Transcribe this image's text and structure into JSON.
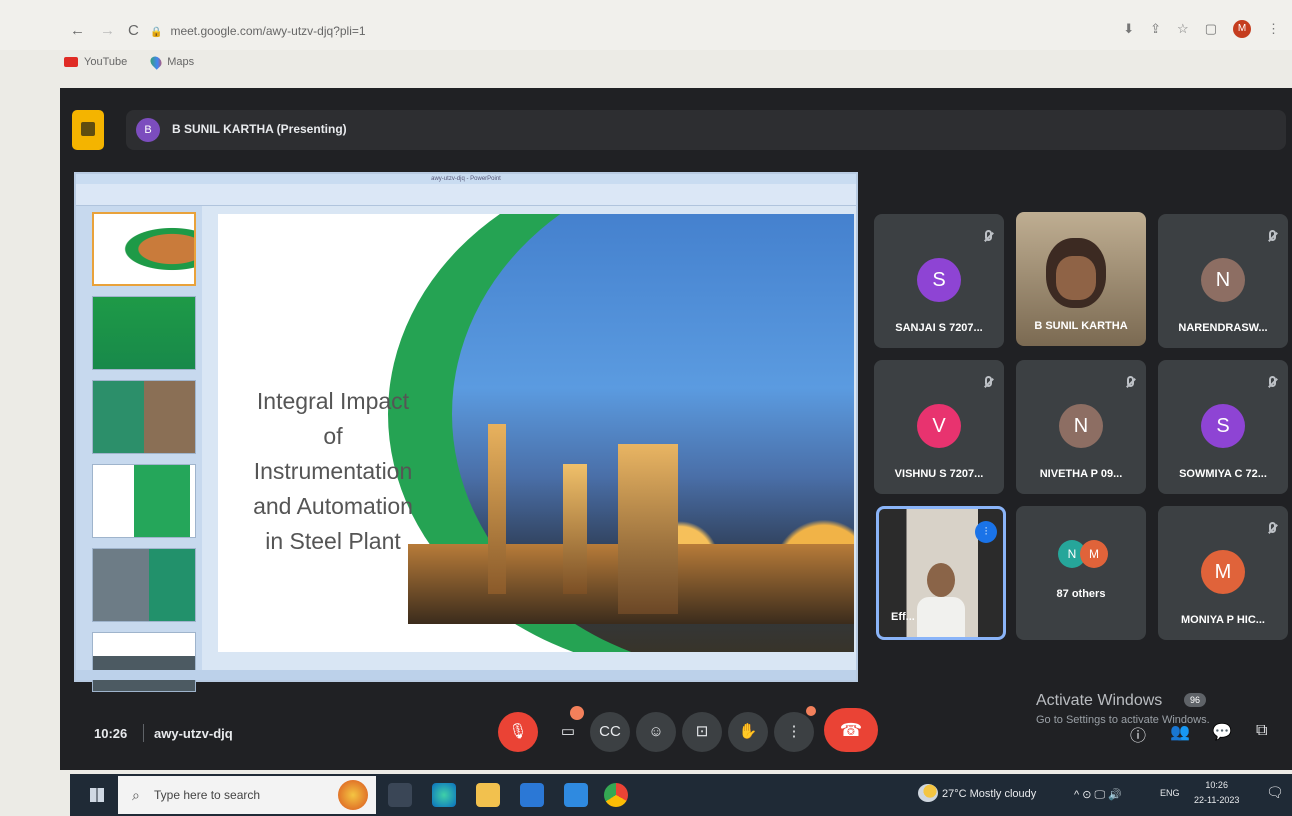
{
  "browser": {
    "url": "meet.google.com/awy-utzv-djq?pli=1",
    "bookmarks": [
      "YouTube",
      "Maps"
    ],
    "profile_initial": "M"
  },
  "meet": {
    "presenter_initial": "B",
    "presenter_label": "B SUNIL KARTHA (Presenting)",
    "slide": {
      "window_title": "awy-utzv-djq - PowerPoint",
      "title_lines": [
        "Integral Impact",
        "of",
        "Instrumentation",
        "and Automation",
        "in Steel Plant"
      ]
    },
    "participants": [
      {
        "name": "SANJAI S 7207...",
        "initial": "S",
        "color": "#8e44d4",
        "muted": true
      },
      {
        "name": "B SUNIL KARTHA",
        "video": true
      },
      {
        "name": "NARENDRASW...",
        "initial": "N",
        "color": "#8d6e63",
        "muted": true
      },
      {
        "name": "VISHNU S 7207...",
        "initial": "V",
        "color": "#e8336f",
        "muted": true
      },
      {
        "name": "NIVETHA P 09...",
        "initial": "N",
        "color": "#8d6e63",
        "muted": true
      },
      {
        "name": "SOWMIYA C 72...",
        "initial": "S",
        "color": "#8e44d4",
        "muted": true
      },
      {
        "name": "Eff...",
        "video": true,
        "speaking": true
      },
      {
        "name": "87 others",
        "initials": [
          "N",
          "M"
        ]
      },
      {
        "name": "MONIYA P HIC...",
        "initial": "M",
        "color": "#e0633a",
        "muted": true
      }
    ],
    "bottom": {
      "time": "10:26",
      "meeting_code": "awy-utzv-djq",
      "people_count": "96",
      "activate_title": "Activate Windows",
      "activate_sub": "Go to Settings to activate Windows."
    }
  },
  "taskbar": {
    "search_placeholder": "Type here to search",
    "weather": "27°C  Mostly cloudy",
    "lang": "ENG",
    "time": "10:26",
    "date": "22-11-2023"
  },
  "colors": {
    "accent_red": "#ea4335",
    "meet_bg": "#202124",
    "tile_bg": "#3c4043",
    "green": "#25a353"
  }
}
